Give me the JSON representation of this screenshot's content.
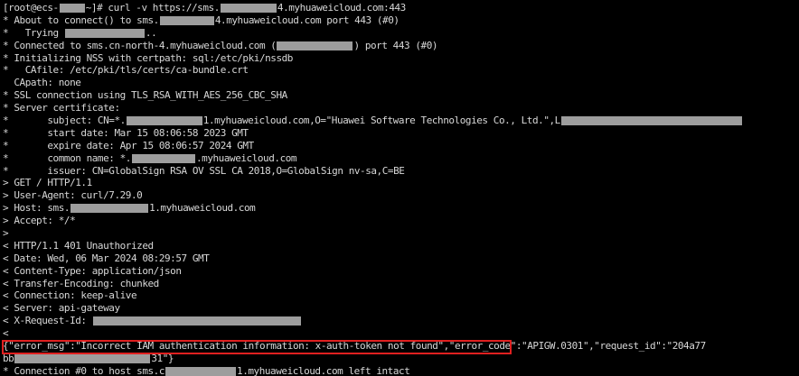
{
  "terminal": {
    "lines": [
      {
        "p1": "[root@ecs-",
        "p2": "~]# curl -v https://sms.",
        "p3": "4.myhuaweicloud.com:443"
      },
      {
        "p1": "* About to connect() to sms.",
        "p2": "4.myhuaweicloud.com port 443 (#0)"
      },
      {
        "p1": "*   Trying ",
        "p2": ".."
      },
      {
        "p1": "* Connected to sms.cn-north-4.myhuaweicloud.com (",
        "p2": ") port 443 (#0)"
      },
      {
        "p1": "* Initializing NSS with certpath: sql:/etc/pki/nssdb"
      },
      {
        "p1": "*   CAfile: /etc/pki/tls/certs/ca-bundle.crt"
      },
      {
        "p1": "  CApath: none"
      },
      {
        "p1": "* SSL connection using TLS_RSA_WITH_AES_256_CBC_SHA"
      },
      {
        "p1": "* Server certificate:"
      },
      {
        "p1": "*       subject: CN=*.",
        "p2": "1.myhuaweicloud.com,O=\"Huawei Software Technologies Co., Ltd.\",L"
      },
      {
        "p1": "*       start date: Mar 15 08:06:58 2023 GMT"
      },
      {
        "p1": "*       expire date: Apr 15 08:06:57 2024 GMT"
      },
      {
        "p1": "*       common name: *.",
        "p2": ".myhuaweicloud.com"
      },
      {
        "p1": "*       issuer: CN=GlobalSign RSA OV SSL CA 2018,O=GlobalSign nv-sa,C=BE"
      },
      {
        "p1": "> GET / HTTP/1.1"
      },
      {
        "p1": "> User-Agent: curl/7.29.0"
      },
      {
        "p1": "> Host: sms.",
        "p2": "1.myhuaweicloud.com"
      },
      {
        "p1": "> Accept: */*"
      },
      {
        "p1": ">"
      },
      {
        "p1": "< HTTP/1.1 401 Unauthorized"
      },
      {
        "p1": "< Date: Wed, 06 Mar 2024 08:29:57 GMT"
      },
      {
        "p1": "< Content-Type: application/json"
      },
      {
        "p1": "< Transfer-Encoding: chunked"
      },
      {
        "p1": "< Connection: keep-alive"
      },
      {
        "p1": "< Server: api-gateway"
      },
      {
        "p1": "< X-Request-Id: "
      },
      {
        "p1": "<"
      },
      {
        "p1": "{\"error_msg\":\"Incorrect IAM authentication information: x-auth-token not found\",\"error_code\":\"APIGW.0301\",\"request_id\":\"204a77"
      },
      {
        "p1": "bb",
        "p2": "31\"}"
      },
      {
        "p1": "* Connection #0 to host sms.c",
        "p2": "1.myhuaweicloud.com left intact"
      }
    ]
  },
  "colors": {
    "background": "#000000",
    "text": "#d8d8d8",
    "highlight": "#e02020"
  }
}
